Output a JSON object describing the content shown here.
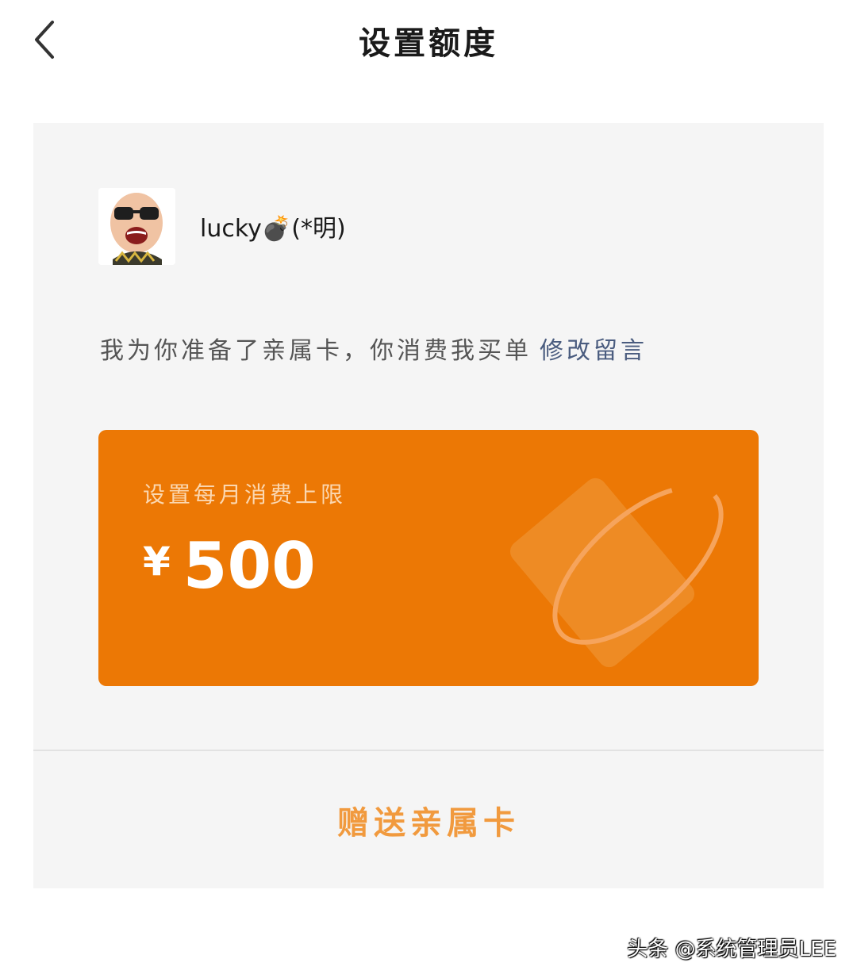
{
  "header": {
    "title": "设置额度",
    "back_icon": "chevron-left-icon"
  },
  "user": {
    "name": "lucky💣(*明)",
    "avatar": "avatar"
  },
  "message": {
    "text": "我为你准备了亲属卡，你消费我买单",
    "edit_label": "修改留言"
  },
  "card": {
    "label": "设置每月消费上限",
    "currency": "¥",
    "amount": "500",
    "color": "#ec7805"
  },
  "footer": {
    "gift_label": "赠送亲属卡"
  },
  "watermark": "头条 @系统管理员LEE"
}
